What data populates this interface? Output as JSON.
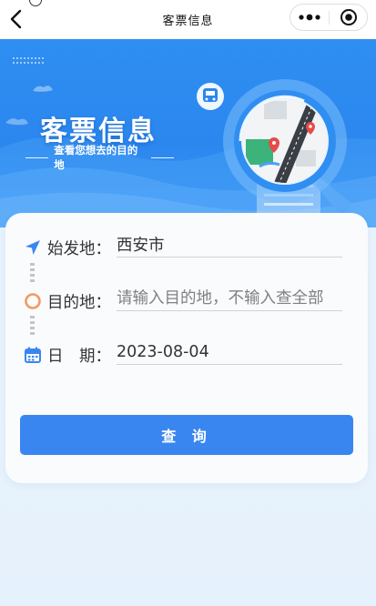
{
  "nav": {
    "title": "客票信息",
    "back_icon": "chevron-left-icon",
    "more_icon": "more-dots-icon",
    "close_icon": "target-circle-icon"
  },
  "banner": {
    "title": "客票信息",
    "subtitle": "查看您想去的目的地",
    "colors": {
      "primary": "#2b87ee",
      "light": "#6cb3fb"
    }
  },
  "form": {
    "origin": {
      "label": "始发地：",
      "value": "西安市",
      "icon": "navigation-arrow-icon"
    },
    "destination": {
      "label": "目的地：",
      "placeholder": "请输入目的地，不输入查全部",
      "value": "",
      "icon": "destination-ring-icon"
    },
    "date": {
      "label": "日　期：",
      "value": "2023-08-04",
      "icon": "calendar-icon"
    }
  },
  "search_button": {
    "label": "查 询",
    "color": "#3a86f0"
  }
}
